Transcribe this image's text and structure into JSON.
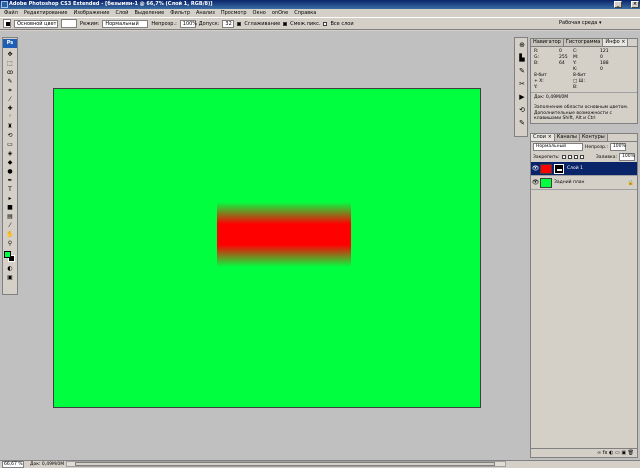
{
  "window": {
    "title": "Adobe Photoshop CS3 Extended - [безымян-1 @ 66,7% (Слой 1, RGB/8)]",
    "buttons": {
      "minimize": "_",
      "maximize": "□",
      "close": "×"
    }
  },
  "menu": [
    "Файл",
    "Редактирование",
    "Изображение",
    "Слой",
    "Выделение",
    "Фильтр",
    "Анализ",
    "Просмотр",
    "Окно",
    "onOne",
    "Справка"
  ],
  "options": {
    "gradient_preset": "Основной цвет",
    "mode_label": "Режим:",
    "mode_value": "Нормальный",
    "opacity_label": "Непрозр.:",
    "opacity_value": "100%",
    "tolerance_label": "Допуск:",
    "tolerance_value": "32",
    "antialias_label": "Сглаживание",
    "contiguous_label": "Смеж.пикс.",
    "all_layers_label": "Все слои",
    "workspace_label": "Рабочая среда ▾"
  },
  "toolbox": {
    "logo": "Ps",
    "tools": [
      "move-tool",
      "marquee-tool",
      "lasso-tool",
      "quick-selection-tool",
      "crop-tool",
      "slice-tool",
      "healing-brush-tool",
      "brush-tool",
      "clone-stamp-tool",
      "history-brush-tool",
      "eraser-tool",
      "paint-bucket-tool",
      "blur-tool",
      "dodge-tool",
      "pen-tool",
      "type-tool",
      "path-selection-tool",
      "shape-tool",
      "notes-tool",
      "eyedropper-tool",
      "hand-tool",
      "zoom-tool"
    ],
    "foreground_color": "#00ff3f",
    "background_color": "#000000"
  },
  "canvas": {
    "fill_color": "#00ff3f",
    "gradient_color": "#ff0000"
  },
  "info_panel": {
    "tabs": [
      "Навигатор",
      "Гистограмма",
      "Инфо ×"
    ],
    "rows": [
      [
        "R:",
        "",
        "",
        "C:",
        "",
        ""
      ],
      [
        "G:",
        "",
        "",
        "M:",
        "",
        ""
      ],
      [
        "B:",
        "",
        "",
        "Y:",
        "",
        ""
      ],
      [
        "",
        "",
        "",
        "K:",
        "",
        ""
      ],
      [
        "8-бит",
        "",
        "",
        "8-бит",
        "",
        ""
      ],
      [
        "+ X:",
        "",
        "",
        "□ Ш:",
        "",
        ""
      ],
      [
        "  Y:",
        "",
        "",
        "  В:",
        "",
        ""
      ]
    ],
    "values_right": [
      "121",
      "0",
      "188",
      "0"
    ],
    "values_left": [
      "0",
      "255",
      "64"
    ],
    "doc": "Док: 0,49M/0M",
    "hint": "Заполнение области основным цветом. Дополнительные возможности с клавишами Shift, Alt и Ctrl"
  },
  "layers_panel": {
    "tabs": [
      "Слои ×",
      "Каналы",
      "Контуры"
    ],
    "blend_mode": "Нормальный",
    "opacity_label": "Непрозр.:",
    "opacity_value": "100%",
    "lock_label": "Закрепить:",
    "fill_label": "Заливка:",
    "fill_value": "100%",
    "layers": [
      {
        "name": "Слой 1",
        "selected": true
      },
      {
        "name": "Задний план",
        "selected": false
      }
    ],
    "bottom_icons": "∞  fx  ◐  ▭  ▣  🗑"
  },
  "statusbar": {
    "zoom": "66,67 %",
    "doc": "Док: 0,49M/0M"
  }
}
